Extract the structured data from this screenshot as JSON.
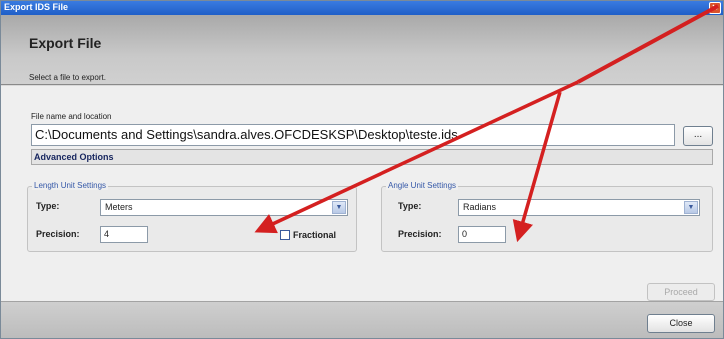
{
  "window": {
    "title": "Export IDS File",
    "close_glyph": "✕"
  },
  "banner": {
    "heading": "Export File",
    "subtitle": "Select a file to export."
  },
  "file": {
    "label": "File name and location",
    "path_value": "C:\\Documents and Settings\\sandra.alves.OFCDESKSP\\Desktop\\teste.ids",
    "browse_label": "..."
  },
  "advanced": {
    "label": "Advanced Options"
  },
  "length_units": {
    "group_title": "Length Unit Settings",
    "type_label": "Type:",
    "type_value": "Meters",
    "precision_label": "Precision:",
    "precision_value": "4",
    "fractional_label": "Fractional",
    "fractional_checked": false
  },
  "angle_units": {
    "group_title": "Angle Unit Settings",
    "type_label": "Type:",
    "type_value": "Radians",
    "precision_label": "Precision:",
    "precision_value": "0"
  },
  "buttons": {
    "proceed": "Proceed",
    "close": "Close"
  },
  "icons": {
    "dropdown": "chevron-down-icon",
    "window_close": "close-icon"
  },
  "colors": {
    "titlebar": "#1f5fc8",
    "annotation_arrow": "#d42020",
    "group_title": "#3558a8"
  }
}
